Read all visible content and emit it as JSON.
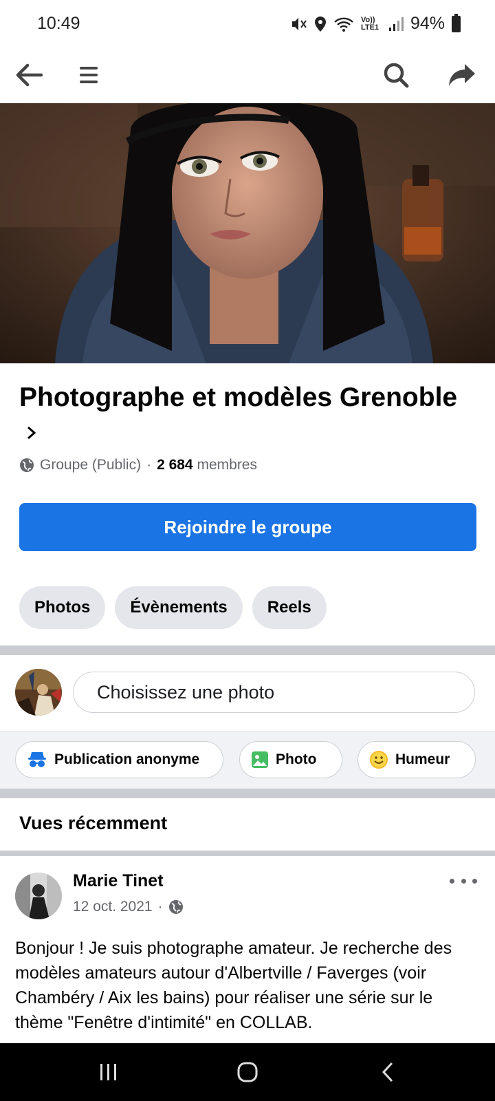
{
  "status_bar": {
    "time": "10:49",
    "network_label": "Vo)) LTE1",
    "battery": "94%"
  },
  "nav": {
    "back_icon": "back-arrow-icon",
    "menu_icon": "hamburger-menu-icon",
    "search_icon": "search-icon",
    "share_icon": "share-icon"
  },
  "group": {
    "title": "Photographe et modèles Grenoble",
    "privacy": "Groupe (Public)",
    "separator": "·",
    "member_count": "2 684",
    "members_label": "membres",
    "join_label": "Rejoindre le groupe",
    "tabs": [
      {
        "label": "Photos"
      },
      {
        "label": "Évènements"
      },
      {
        "label": "Reels"
      }
    ]
  },
  "composer": {
    "placeholder": "Choisissez une photo",
    "actions": [
      {
        "label": "Publication anonyme",
        "icon": "anonymous-icon",
        "color": "#1b74e4"
      },
      {
        "label": "Photo",
        "icon": "photo-icon",
        "color": "#45bd62"
      },
      {
        "label": "Humeur",
        "icon": "smiley-icon",
        "color": "#f7b928"
      }
    ]
  },
  "recent": {
    "title": "Vues récemment"
  },
  "post": {
    "author": "Marie Tinet",
    "date": "12 oct. 2021",
    "separator": "·",
    "text": "Bonjour ! Je suis photographe amateur. Je recherche des modèles amateurs autour d'Albertville / Faverges (voir Chambéry / Aix les bains) pour réaliser une série sur le thème \"Fenêtre d'intimité\" en COLLAB."
  },
  "colors": {
    "accent": "#1b74e4",
    "chip_bg": "#e4e6eb",
    "secondary_text": "#65676b"
  }
}
